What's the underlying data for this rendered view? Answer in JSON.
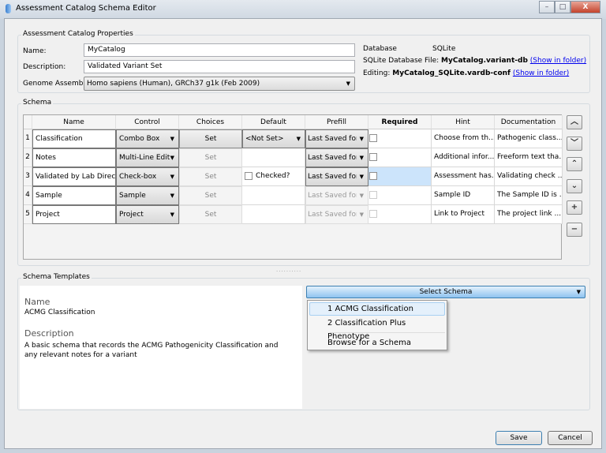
{
  "window": {
    "title": "Assessment Catalog Schema Editor",
    "controls": [
      "–",
      "□",
      "X"
    ]
  },
  "properties": {
    "group_label": "Assessment Catalog Properties",
    "name_label": "Name:",
    "name_value": "MyCatalog",
    "description_label": "Description:",
    "description_value": "Validated Variant Set",
    "genome_label": "Genome Assembly:",
    "genome_value": "Homo sapiens (Human), GRCh37 g1k (Feb 2009)",
    "database_label": "Database",
    "database_value": "SQLite",
    "file_label": "SQLite Database File:",
    "file_value": "MyCatalog.variant-db",
    "file_link": "(Show in folder)",
    "editing_label": "Editing:",
    "editing_value": "MyCatalog_SQLite.vardb-conf",
    "editing_link": "(Show in folder)"
  },
  "schema": {
    "group_label": "Schema",
    "columns": [
      "Name",
      "Control",
      "Choices",
      "Default",
      "Prefill",
      "Required",
      "Hint",
      "Documentation"
    ],
    "rows": [
      {
        "num": "1",
        "name": "Classification",
        "control": "Combo Box",
        "choices": "Set",
        "choices_enabled": true,
        "default": "<Not Set>",
        "default_type": "combo",
        "prefill": "Last Saved for V",
        "prefill_enabled": true,
        "required": false,
        "hint": "Choose from th...",
        "doc": "Pathogenic class..."
      },
      {
        "num": "2",
        "name": "Notes",
        "control": "Multi-Line Edit",
        "choices": "Set",
        "choices_enabled": false,
        "default": "",
        "default_type": "none",
        "prefill": "Last Saved for V",
        "prefill_enabled": true,
        "required": false,
        "hint": "Additional infor...",
        "doc": "Freeform text tha..."
      },
      {
        "num": "3",
        "name": "Validated by Lab Director",
        "control": "Check-box",
        "choices": "Set",
        "choices_enabled": false,
        "default": "Checked?",
        "default_type": "checkbox",
        "prefill": "Last Saved for V",
        "prefill_enabled": true,
        "required": false,
        "selected": true,
        "hint": "Assessment has...",
        "doc": "Validating check ..."
      },
      {
        "num": "4",
        "name": "Sample",
        "control": "Sample",
        "choices": "Set",
        "choices_enabled": false,
        "default": "",
        "default_type": "none",
        "prefill": "Last Saved for S",
        "prefill_enabled": false,
        "required": false,
        "hint": "Sample ID",
        "doc": "The Sample ID is ..."
      },
      {
        "num": "5",
        "name": "Project",
        "control": "Project",
        "choices": "Set",
        "choices_enabled": false,
        "default": "",
        "default_type": "none",
        "prefill": "Last Saved for P",
        "prefill_enabled": false,
        "required": false,
        "hint": "Link to Project",
        "doc": "The project link ..."
      }
    ],
    "side_buttons": [
      {
        "name": "move-up",
        "glyph": "︿"
      },
      {
        "name": "move-down",
        "glyph": "﹀"
      },
      {
        "name": "move-top",
        "glyph": "⌃"
      },
      {
        "name": "move-bottom",
        "glyph": "⌄"
      },
      {
        "name": "add",
        "glyph": "+"
      },
      {
        "name": "remove",
        "glyph": "−"
      }
    ]
  },
  "templates": {
    "group_label": "Schema Templates",
    "name_heading": "Name",
    "name_value": "ACMG Classification",
    "description_heading": "Description",
    "description_value": "A basic schema that records the ACMG Pathogenicity Classification and any relevant notes for a variant",
    "select_label": "Select Schema",
    "menu": [
      "1 ACMG Classification",
      "2 Classification Plus Phenotype",
      "Browse for a Schema"
    ]
  },
  "footer": {
    "save": "Save",
    "cancel": "Cancel"
  },
  "colors": {
    "select_blue": "#8fc3f0",
    "selection": "#cce4fb"
  }
}
